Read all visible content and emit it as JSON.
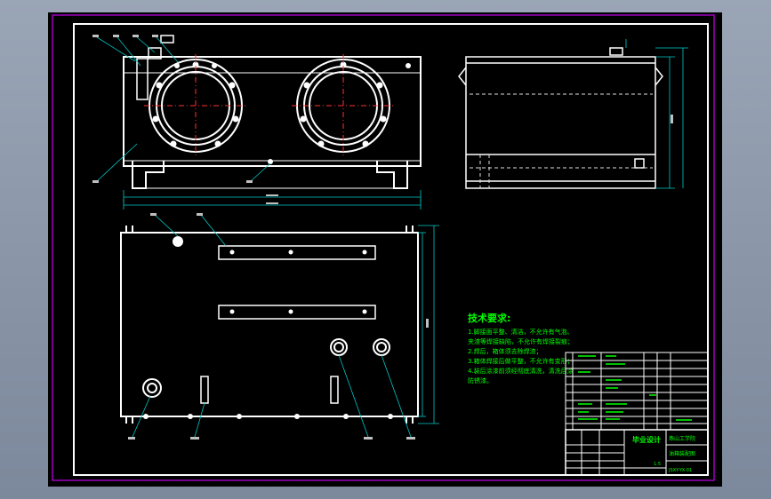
{
  "drawing": {
    "tech_title": "技术要求:",
    "requirements": [
      "1.脚接面平整、清洁，不允许有气泡、",
      "  夹渣等焊接缺陷，不允许有焊接裂痕；",
      "2.焊后，箱体须去除焊渣；",
      "3.箱体焊接后做平整，不允许有变形；",
      "4.装后涂漆前须经彻底清洗，清洗后涂",
      "  防锈漆。"
    ],
    "title_block": {
      "designer": "毕业设计",
      "school": "燕山工学院",
      "drawing_name": "油箱装配图",
      "drawing_no": "JSXY-YX-01",
      "scale": "1:5"
    },
    "colors": {
      "outline": "#ffffff",
      "frame": "#a000c0",
      "dimension": "#00c8c8",
      "center_line": "#ff3030",
      "notes": "#00ff00",
      "hidden": "#e0e0e0"
    }
  }
}
